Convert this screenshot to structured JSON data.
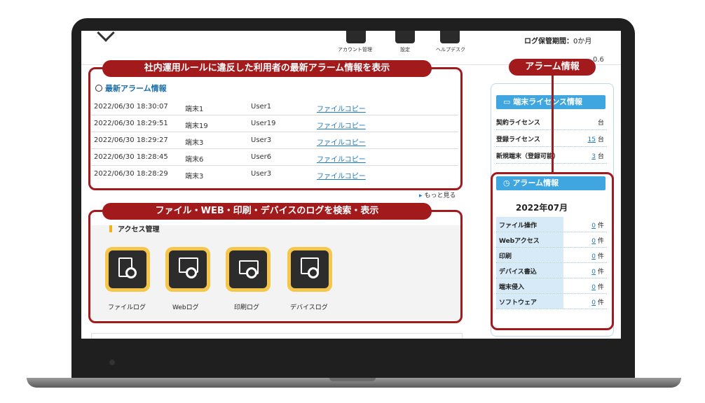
{
  "header": {
    "nav": [
      {
        "label": "アカウント管理"
      },
      {
        "label": "設定"
      },
      {
        "label": "ヘルプデスク"
      }
    ],
    "log_period_label": "ログ保管期間：",
    "log_period_value": "0か月",
    "version": "0.6"
  },
  "callouts": {
    "alarm_banner": "社内運用ルールに違反した利用者の最新アラーム情報を表示",
    "log_banner": "ファイル・WEB・印刷・デバイスのログを検索・表示",
    "sidebar_banner": "アラーム情報"
  },
  "alarms": {
    "title": "最新アラーム情報",
    "rows": [
      {
        "time": "2022/06/30 18:30:07",
        "terminal": "端末1",
        "user": "User1",
        "action": "ファイルコピー"
      },
      {
        "time": "2022/06/30 18:29:51",
        "terminal": "端末19",
        "user": "User19",
        "action": "ファイルコピー"
      },
      {
        "time": "2022/06/30 18:29:27",
        "terminal": "端末3",
        "user": "User3",
        "action": "ファイルコピー"
      },
      {
        "time": "2022/06/30 18:28:45",
        "terminal": "端末6",
        "user": "User6",
        "action": "ファイルコピー"
      },
      {
        "time": "2022/06/30 18:28:29",
        "terminal": "端末3",
        "user": "User3",
        "action": "ファイルコピー"
      }
    ],
    "more": "もっと見る"
  },
  "access": {
    "title": "アクセス管理",
    "tools": [
      {
        "label": "ファイルログ"
      },
      {
        "label": "Webログ"
      },
      {
        "label": "印刷ログ"
      },
      {
        "label": "デバイスログ"
      }
    ]
  },
  "license": {
    "title": "端末ライセンス情報",
    "rows": [
      {
        "key": "契約ライセンス",
        "value": "",
        "unit": "台"
      },
      {
        "key": "登録ライセンス",
        "value": "15",
        "unit": "台"
      },
      {
        "key": "新規端末（登録可能）",
        "value": "3",
        "unit": "台"
      }
    ]
  },
  "alarm_info": {
    "title": "アラーム情報",
    "month": "2022年07月",
    "rows": [
      {
        "key": "ファイル操作",
        "value": "0",
        "unit": "件"
      },
      {
        "key": "Webアクセス",
        "value": "0",
        "unit": "件"
      },
      {
        "key": "印刷",
        "value": "0",
        "unit": "件"
      },
      {
        "key": "デバイス書込",
        "value": "0",
        "unit": "件"
      },
      {
        "key": "端末侵入",
        "value": "0",
        "unit": "件"
      },
      {
        "key": "ソフトウェア",
        "value": "0",
        "unit": "件"
      }
    ]
  }
}
